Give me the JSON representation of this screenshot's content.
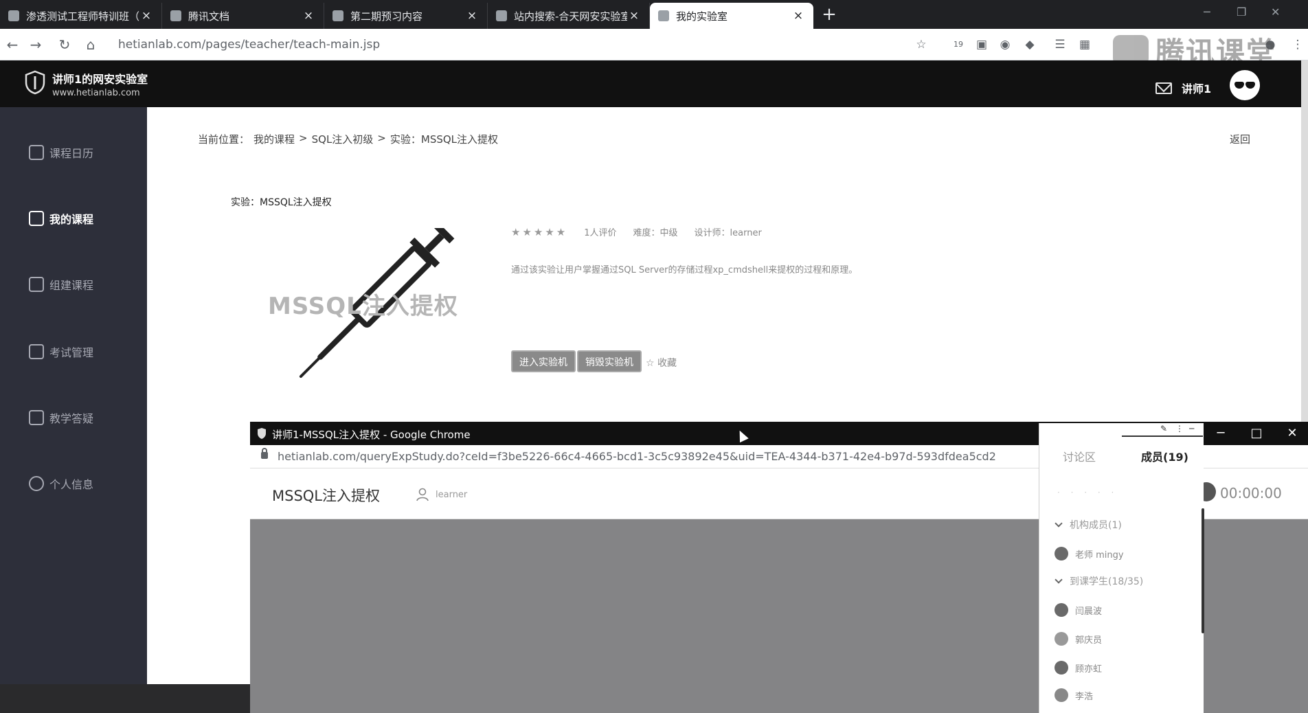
{
  "browser": {
    "tabs": [
      {
        "label": "渗透测试工程师特训班（Kali攻",
        "active": false
      },
      {
        "label": "腾讯文档",
        "active": false
      },
      {
        "label": "第二期预习内容",
        "active": false
      },
      {
        "label": "站内搜索-合天网安实验室",
        "active": false
      },
      {
        "label": "我的实验室",
        "active": true
      }
    ],
    "new_tab": "+",
    "url": "hetianlab.com/pages/teacher/teach-main.jsp",
    "extension_badge": "19",
    "watermark": "腾讯课堂"
  },
  "site": {
    "title": "讲师1的网安实验室",
    "subtitle": "www.hetianlab.com",
    "user": "讲师1"
  },
  "sidebar": {
    "items": [
      {
        "label": "课程日历",
        "icon": "calendar-icon",
        "active": false
      },
      {
        "label": "我的课程",
        "icon": "book-icon",
        "active": true
      },
      {
        "label": "组建课程",
        "icon": "plus-square-icon",
        "active": false
      },
      {
        "label": "考试管理",
        "icon": "edit-icon",
        "active": false
      },
      {
        "label": "教学答疑",
        "icon": "qa-icon",
        "active": false
      },
      {
        "label": "个人信息",
        "icon": "person-icon",
        "active": false
      }
    ]
  },
  "main": {
    "breadcrumb": [
      "当前位置：",
      "我的课程",
      ">",
      "SQL注入初级",
      ">",
      "实验：MSSQL注入提权"
    ],
    "back": "返回",
    "experiment_title": "实验：MSSQL注入提权",
    "cover_text": "MSSQL注入提权",
    "stars": "★★★★★",
    "rating_count": "1人评价",
    "difficulty": "难度：中级",
    "designer": "设计师：learner",
    "description": "通过该实验让用户掌握通过SQL Server的存储过程xp_cmdshell来提权的过程和原理。",
    "btn_enter": "进入实验机",
    "btn_destroy": "销毁实验机",
    "favorite": "☆ 收藏"
  },
  "popup": {
    "window_title": "讲师1-MSSQL注入提权 - Google Chrome",
    "url": "hetianlab.com/queryExpStudy.do?ceId=f3be5226-66c4-4665-bcd1-3c5c93892e45&uid=TEA-4344-b371-42e4-b97d-593dfdea5cd2",
    "experiment_title": "MSSQL注入提权",
    "user": "learner",
    "timer": "00:00:00"
  },
  "panel": {
    "tabs": [
      {
        "label": "讨论区",
        "active": false
      },
      {
        "label": "成员(19)",
        "active": true
      }
    ],
    "groups": [
      {
        "label": "机构成员(1)",
        "members": [
          {
            "name": "老师 mingy"
          }
        ]
      },
      {
        "label": "到课学生(18/35)",
        "members": [
          {
            "name": "闫晨波"
          },
          {
            "name": "郭庆员"
          },
          {
            "name": "顾亦虹"
          },
          {
            "name": "李浩"
          }
        ]
      }
    ]
  }
}
